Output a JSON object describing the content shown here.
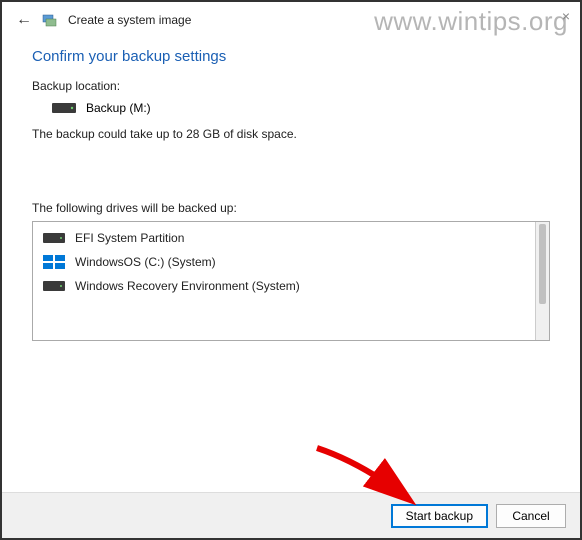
{
  "watermark": "www.wintips.org",
  "titlebar": {
    "title": "Create a system image"
  },
  "heading": "Confirm your backup settings",
  "backup_location_label": "Backup location:",
  "backup_location_value": "Backup (M:)",
  "space_text": "The backup could take up to 28 GB of disk space.",
  "drives_label": "The following drives will be backed up:",
  "drives": [
    {
      "name": "EFI System Partition",
      "icon": "hdd"
    },
    {
      "name": "WindowsOS (C:) (System)",
      "icon": "win"
    },
    {
      "name": "Windows Recovery Environment (System)",
      "icon": "hdd"
    }
  ],
  "buttons": {
    "start": "Start backup",
    "cancel": "Cancel"
  }
}
